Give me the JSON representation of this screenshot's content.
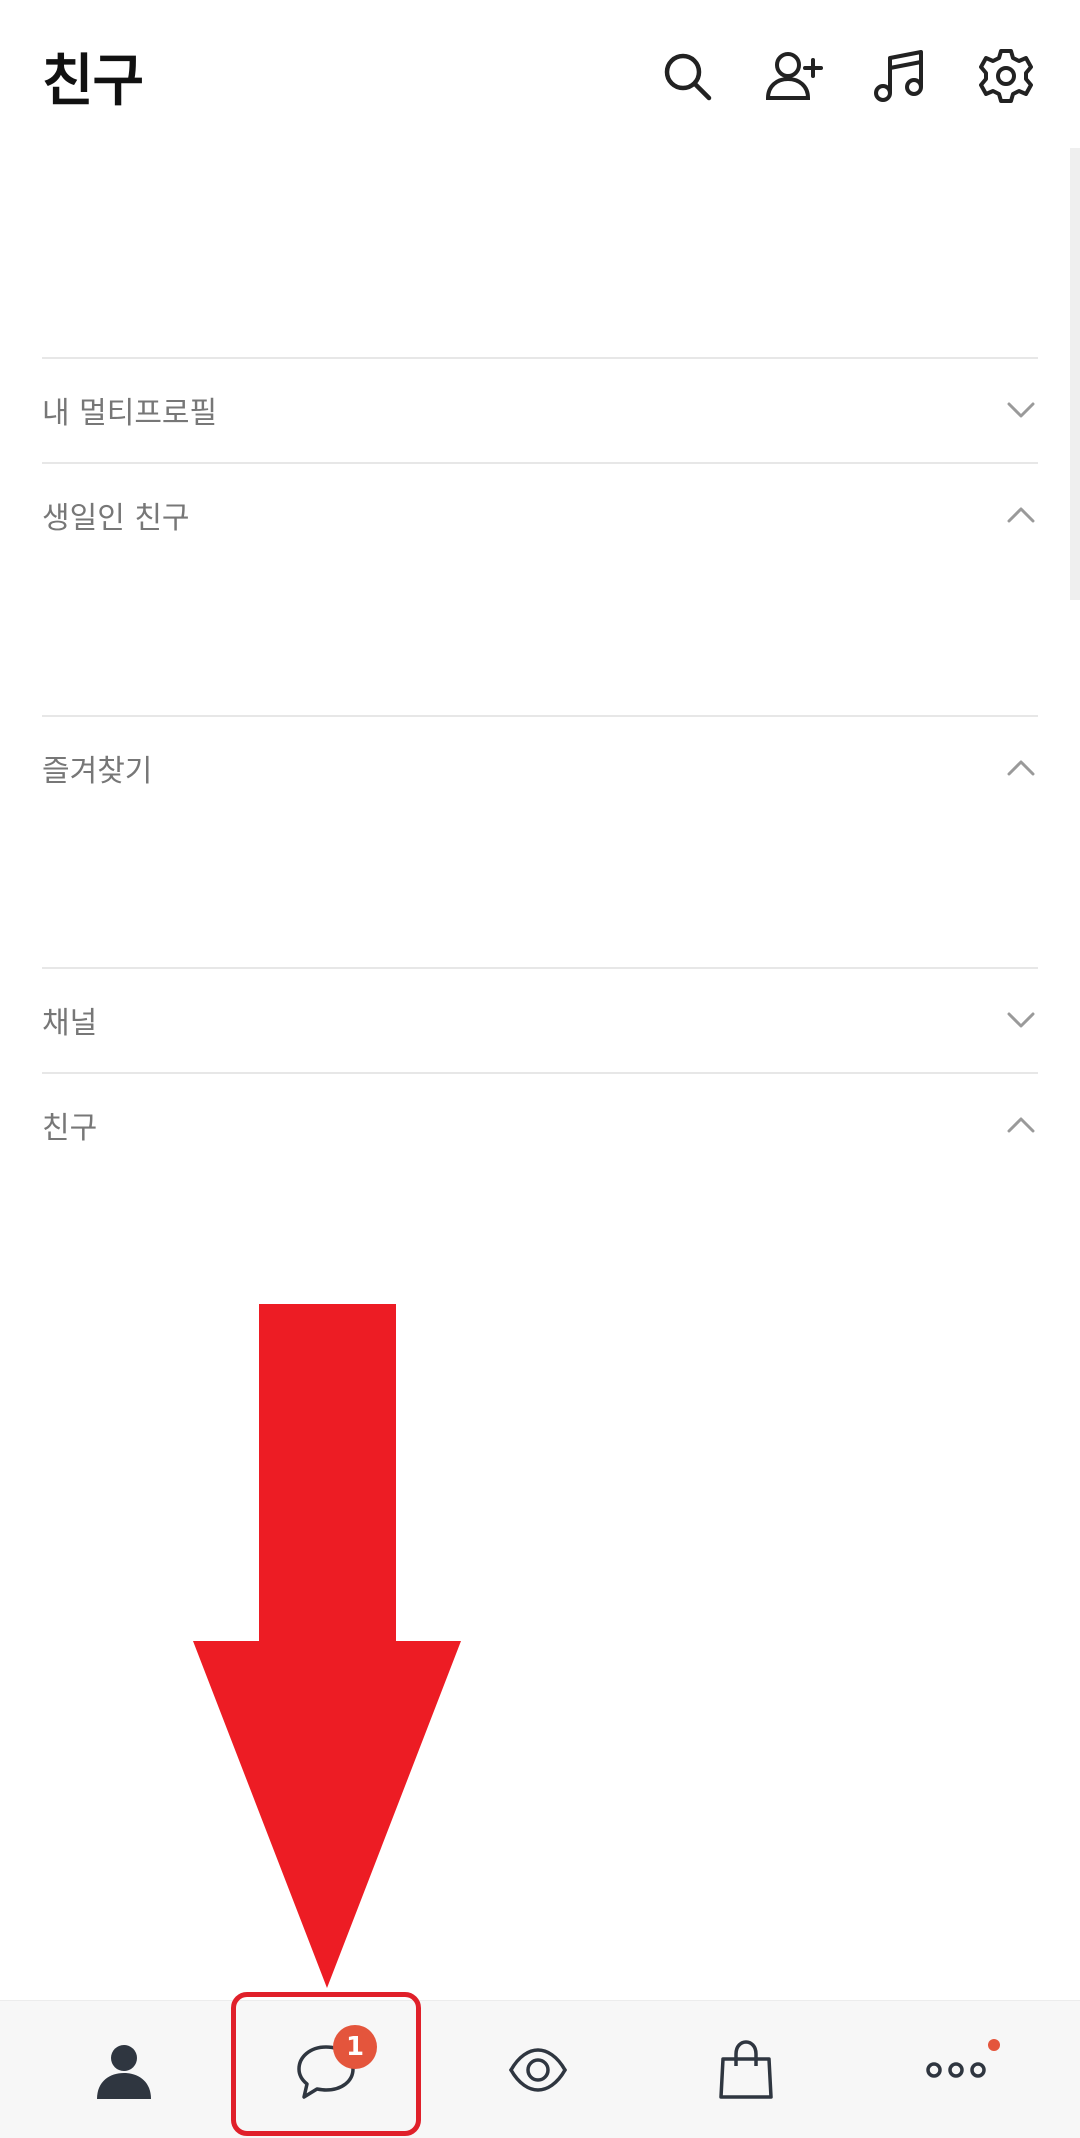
{
  "header": {
    "title": "친구",
    "icons": [
      "search-icon",
      "add-friend-icon",
      "music-icon",
      "settings-icon"
    ]
  },
  "sections": [
    {
      "label": "내 멀티프로필",
      "state": "collapsed"
    },
    {
      "label": "생일인 친구",
      "state": "expanded"
    },
    {
      "label": "즐겨찾기",
      "state": "expanded"
    },
    {
      "label": "채널",
      "state": "collapsed"
    },
    {
      "label": "친구",
      "state": "expanded"
    }
  ],
  "bottom_nav": {
    "items": [
      "friends-tab",
      "chats-tab",
      "view-tab",
      "shopping-tab",
      "more-tab"
    ],
    "chat_badge": "1"
  },
  "colors": {
    "annotation_red": "#ED1C24",
    "badge": "#E4553C",
    "divider": "#E7E7E7"
  }
}
